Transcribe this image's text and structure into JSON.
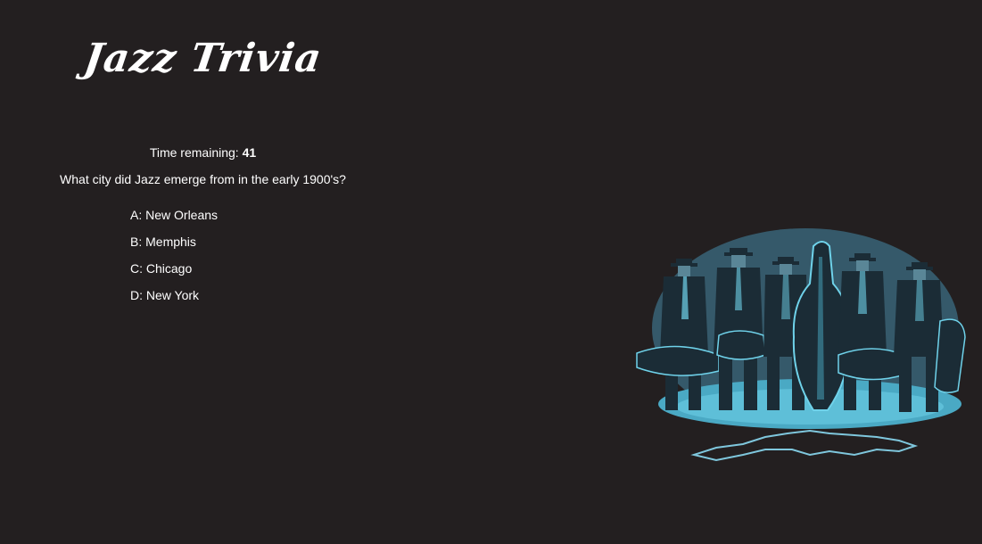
{
  "app": {
    "title": "Jazz Trivia"
  },
  "timer": {
    "label": "Time remaining:",
    "value": "41"
  },
  "question": {
    "text": "What city did Jazz emerge from in the early 1900's?"
  },
  "answers": [
    {
      "letter": "A:",
      "text": "New Orleans"
    },
    {
      "letter": "B:",
      "text": "Memphis"
    },
    {
      "letter": "C:",
      "text": "Chicago"
    },
    {
      "letter": "D:",
      "text": "New York"
    }
  ],
  "colors": {
    "background": "#231f20",
    "text": "#ffffff",
    "illustration_dark": "#1b2c36",
    "illustration_mid": "#3d6e80",
    "illustration_light": "#6fd2ea"
  },
  "illustration": {
    "icon": "jazz-musicians-illustration"
  }
}
